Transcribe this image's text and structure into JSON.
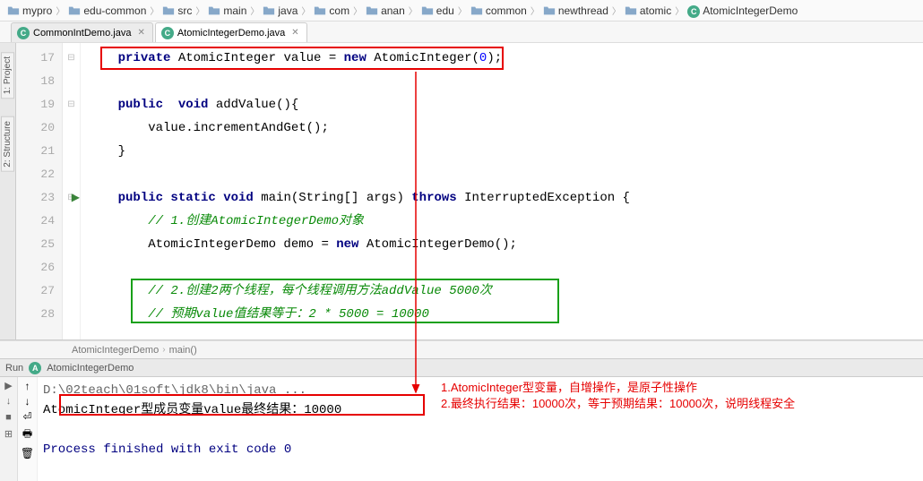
{
  "breadcrumb": [
    "mypro",
    "edu-common",
    "src",
    "main",
    "java",
    "com",
    "anan",
    "edu",
    "common",
    "newthread",
    "atomic",
    "AtomicIntegerDemo"
  ],
  "breadcrumb_icons": [
    "folder",
    "folder",
    "folder",
    "folder",
    "folder",
    "folder",
    "folder",
    "folder",
    "folder",
    "folder",
    "folder",
    "class"
  ],
  "tabs": [
    {
      "icon": "class",
      "label": "CommonIntDemo.java",
      "active": false
    },
    {
      "icon": "class",
      "label": "AtomicIntegerDemo.java",
      "active": true
    }
  ],
  "side_tabs": [
    "1: Project",
    "2: Structure"
  ],
  "gutter": {
    "start": 17,
    "end": 28,
    "run_marker_at": 23
  },
  "code_lines": [
    {
      "n": 17,
      "html": "    <span class='kw'>private</span> AtomicInteger value = <span class='kw'>new</span> AtomicInteger(<span class='num'>0</span>);"
    },
    {
      "n": 18,
      "html": ""
    },
    {
      "n": 19,
      "html": "    <span class='kw'>public</span>  <span class='kw'>void</span> addValue(){"
    },
    {
      "n": 20,
      "html": "        value.incrementAndGet();"
    },
    {
      "n": 21,
      "html": "    }"
    },
    {
      "n": 22,
      "html": ""
    },
    {
      "n": 23,
      "html": "    <span class='kw'>public static void</span> main(String[] args) <span class='kw'>throws</span> InterruptedException {"
    },
    {
      "n": 24,
      "html": "        <span class='com-g'>// 1.创建AtomicIntegerDemo对象</span>"
    },
    {
      "n": 25,
      "html": "        AtomicIntegerDemo demo = <span class='kw'>new</span> AtomicIntegerDemo();"
    },
    {
      "n": 26,
      "html": ""
    },
    {
      "n": 27,
      "html": "        <span class='com-g'>// 2.创建2两个线程，每个线程调用方法addValue 5000次</span>"
    },
    {
      "n": 28,
      "html": "        <span class='com-g'>// 预期value值结果等于：2 * 5000 = 10000</span>"
    }
  ],
  "editor_breadcrumb": [
    "AtomicIntegerDemo",
    "main()"
  ],
  "run_header": {
    "label": "Run",
    "config": "AtomicIntegerDemo"
  },
  "console": {
    "java_path": "D:\\02teach\\01soft\\jdk8\\bin\\java ...",
    "result": "AtomicInteger型成员变量value最终结果：10000",
    "exit": "Process finished with exit code 0"
  },
  "annotations": {
    "line1": "1.AtomicInteger型变量，自增操作，是原子性操作",
    "line2": "2.最终执行结果：10000次，等于预期结果：10000次，说明线程安全"
  }
}
